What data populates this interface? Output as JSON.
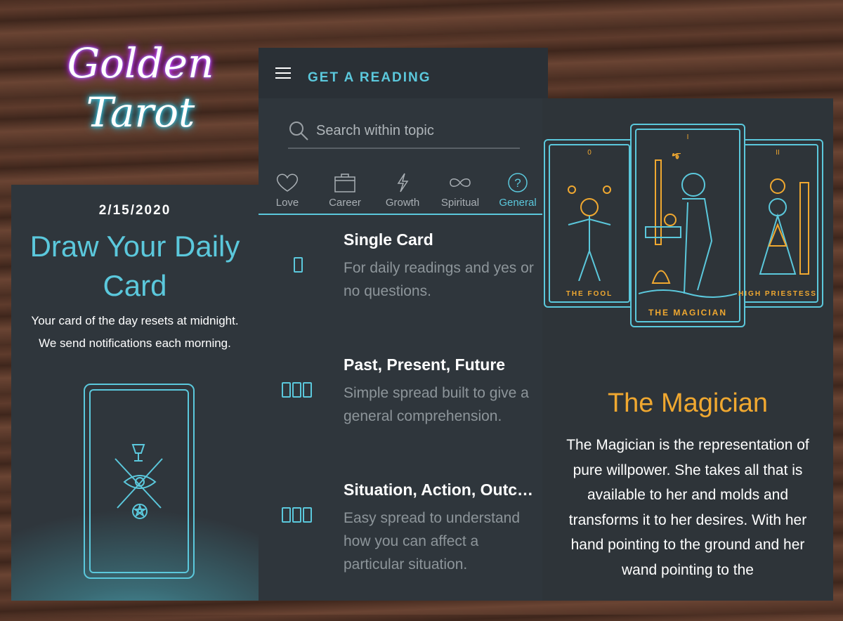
{
  "logo": {
    "line1": "Golden",
    "line2": "Tarot"
  },
  "daily": {
    "date": "2/15/2020",
    "title": "Draw Your Daily Card",
    "line1": "Your card of the day resets at midnight.",
    "line2": "We send notifications each morning."
  },
  "reading": {
    "header": "GET A READING",
    "search_placeholder": "Search within topic",
    "tabs": [
      {
        "label": "Love",
        "icon": "heart-icon"
      },
      {
        "label": "Career",
        "icon": "briefcase-icon"
      },
      {
        "label": "Growth",
        "icon": "lightning-icon"
      },
      {
        "label": "Spiritual",
        "icon": "infinity-icon"
      },
      {
        "label": "General",
        "icon": "question-icon",
        "active": true
      }
    ],
    "spreads": [
      {
        "title": "Single Card",
        "desc": "For daily readings and yes or no questions."
      },
      {
        "title": "Past, Present, Future",
        "desc": "Simple spread built to give a general comprehension."
      },
      {
        "title": "Situation, Action, Outcome",
        "desc": "Easy spread to understand how you can affect a particular situation."
      }
    ]
  },
  "card_detail": {
    "cards": [
      {
        "num": "0",
        "name": "THE FOOL"
      },
      {
        "num": "I",
        "name": "THE MAGICIAN"
      },
      {
        "num": "II",
        "name": "HIGH PRIESTESS"
      }
    ],
    "title": "The Magician",
    "desc": "The Magician is the representation of pure willpower. She takes all that is available to her and molds and transforms it to her desires. With her hand pointing to the ground and her wand pointing to the"
  },
  "colors": {
    "accent": "#5bc8dc",
    "gold": "#f0a830",
    "panel": "#2f363c"
  }
}
